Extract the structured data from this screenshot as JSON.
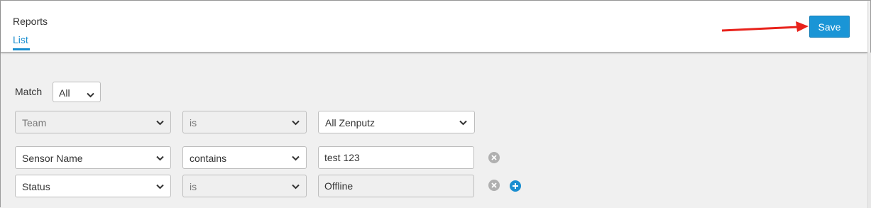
{
  "header": {
    "title": "Reports",
    "tabs": [
      {
        "label": "List",
        "active": true
      }
    ],
    "save_label": "Save"
  },
  "match": {
    "label": "Match",
    "value": "All"
  },
  "rows": [
    {
      "field": "Team",
      "operator": "is",
      "value": "All Zenputz",
      "value_type": "select",
      "disabled": true,
      "removable": false
    },
    {
      "field": "Sensor Name",
      "operator": "contains",
      "value": "test 123",
      "value_type": "text",
      "disabled": false,
      "removable": true
    },
    {
      "field": "Status",
      "operator": "is",
      "value": "Offline",
      "value_type": "text",
      "disabled": false,
      "removable": true,
      "addable": true
    }
  ],
  "colors": {
    "accent": "#1a95d6",
    "arrow": "#e8231c",
    "remove_icon": "#b0b0b0"
  }
}
